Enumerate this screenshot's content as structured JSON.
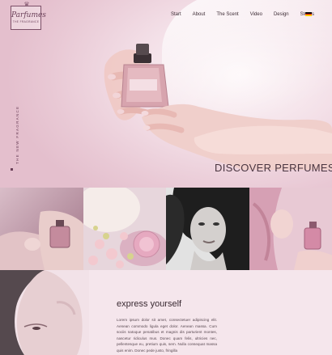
{
  "logo": {
    "brand": "Parfumes",
    "tagline": "THE FRAGRANCE"
  },
  "nav": {
    "items": [
      {
        "label": "Start"
      },
      {
        "label": "About"
      },
      {
        "label": "The Scent"
      },
      {
        "label": "Video"
      },
      {
        "label": "Design"
      },
      {
        "label": "Stores"
      }
    ],
    "language": "de-flag-icon"
  },
  "hero": {
    "vertical_text": "THE NEW FRAGRANCE",
    "headline": "DISCOVER PERFUMES"
  },
  "gallery": {
    "tiles": [
      "hands-with-perfume-bottle",
      "bath-flowers-petals",
      "woman-portrait-bw",
      "woman-spraying-perfume"
    ]
  },
  "section": {
    "headline": "express yourself",
    "body": "Lorem ipsum dolor sit amet, consectetuer adipiscing elit. Aenean commodo ligula eget dolor. Aenean massa. Cum sociis natoque penatibus et magnis dis parturient montes, nascetur ridiculus mus. Donec quam felis, ultricies nec, pellentesque eu, pretium quis, sem. Nulla consequat massa quis enim. Donec pede justo, fringilla"
  },
  "colors": {
    "accent": "#6a3f58",
    "background": "#f4e3ea",
    "hero_pink": "#e9c9d5"
  }
}
